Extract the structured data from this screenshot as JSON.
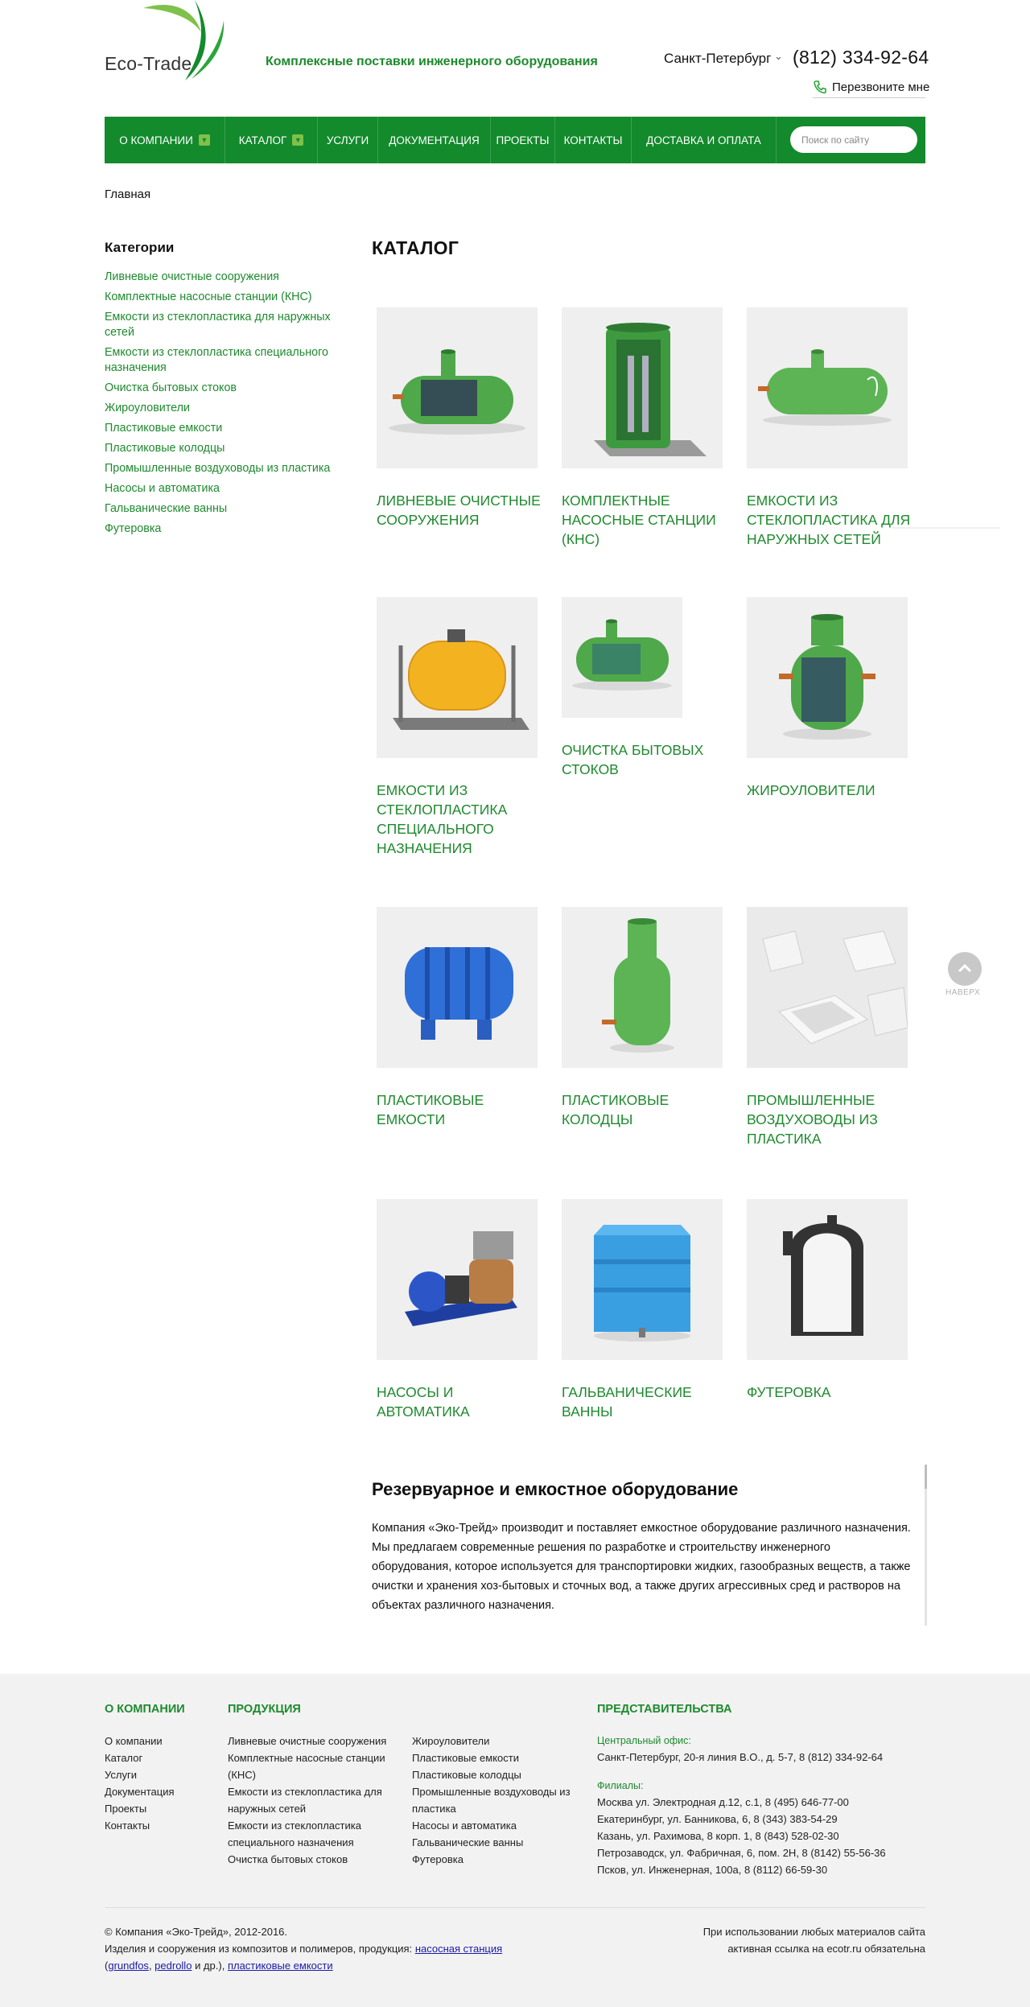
{
  "header": {
    "logo_text": "Eco-Trade",
    "tagline": "Комплексные поставки инженерного оборудования",
    "city": "Санкт-Петербург",
    "phone": "(812) 334-92-64",
    "callback": "Перезвоните мне"
  },
  "nav": {
    "items": [
      {
        "label": "О компании",
        "has_dropdown": true
      },
      {
        "label": "Каталог",
        "has_dropdown": true
      },
      {
        "label": "Услуги",
        "has_dropdown": false
      },
      {
        "label": "Документация",
        "has_dropdown": false
      },
      {
        "label": "Проекты",
        "has_dropdown": false
      },
      {
        "label": "Контакты",
        "has_dropdown": false
      },
      {
        "label": "Доставка и оплата",
        "has_dropdown": false
      }
    ],
    "search_placeholder": "Поиск по сайту"
  },
  "breadcrumb": "Главная",
  "sidebar": {
    "title": "Категории",
    "items": [
      "Ливневые очистные сооружения",
      "Комплектные насосные станции (КНС)",
      "Емкости из стеклопластика для наружных сетей",
      "Емкости из стеклопластика специального назначения",
      "Очистка бытовых стоков",
      "Жироуловители",
      "Пластиковые емкости",
      "Пластиковые колодцы",
      "Промышленные воздуховоды из пластика",
      "Насосы и автоматика",
      "Гальванические ванны",
      "Футеровка"
    ]
  },
  "catalog": {
    "title": "КАТАЛОГ",
    "cards": [
      {
        "label": "Ливневые очистные сооружения",
        "image": "green-horizontal-tank-cutaway"
      },
      {
        "label": "Комплектные насосные станции (КНС)",
        "image": "green-vertical-pump-station"
      },
      {
        "label": "Емкости из стеклопластика для наружных сетей",
        "image": "green-horizontal-tank"
      },
      {
        "label": "Емкости из стеклопластика специального назначения",
        "image": "yellow-tank-on-frame"
      },
      {
        "label": "Очистка бытовых стоков",
        "image": "green-tank-cutaway-small"
      },
      {
        "label": "Жироуловители",
        "image": "green-grease-trap"
      },
      {
        "label": "Пластиковые емкости",
        "image": "blue-ribbed-tank"
      },
      {
        "label": "Пластиковые колодцы",
        "image": "green-vertical-well"
      },
      {
        "label": "Промышленные воздуховоды из пластика",
        "image": "white-plastic-ducts"
      },
      {
        "label": "Насосы и автоматика",
        "image": "blue-pump-motor"
      },
      {
        "label": "Гальванические ванны",
        "image": "blue-bath-tank"
      },
      {
        "label": "Футеровка",
        "image": "lined-vessel-cutaway"
      }
    ]
  },
  "back_to_top": "НАВЕРХ",
  "about": {
    "title": "Резервуарное и емкостное оборудование",
    "text": "Компания «Эко-Трейд» производит и поставляет емкостное оборудование различного назначения. Мы предлагаем современные решения по разработке и строительству инженерного оборудования, которое используется для транспортировки жидких, газообразных веществ, а также очистки и хранения хоз-бытовых и сточных вод, а также других агрессивных сред и растворов на объектах различного назначения."
  },
  "footer": {
    "company_title": "О компании",
    "company_links": [
      "О компании",
      "Каталог",
      "Услуги",
      "Документация",
      "Проекты",
      "Контакты"
    ],
    "products_title": "Продукция",
    "products_col1": [
      "Ливневые очистные сооружения",
      "Комплектные насосные станции (КНС)",
      "Емкости из стеклопластика для наружных сетей",
      "Емкости из стеклопластика специального назначения",
      "Очистка бытовых стоков"
    ],
    "products_col2": [
      "Жироуловители",
      "Пластиковые емкости",
      "Пластиковые колодцы",
      "Промышленные воздуховоды из пластика",
      "Насосы и автоматика",
      "Гальванические ванны",
      "Футеровка"
    ],
    "offices_title": "Представительства",
    "central_label": "Центральный офис:",
    "central_text": "Санкт-Петербург, 20-я линия В.О., д. 5-7, 8 (812) 334-92-64",
    "branches_label": "Филиалы:",
    "branches": [
      "Москва ул. Электродная д.12, с.1, 8 (495) 646-77-00",
      "Екатеринбург, ул. Банникова, 6, 8 (343) 383-54-29",
      "Казань, ул. Рахимова, 8 корп. 1, 8 (843) 528-02-30",
      "Петрозаводск, ул. Фабричная, 6, пом. 2Н, 8 (8142) 55-56-36",
      "Псков, ул. Инженерная, 100а, 8 (8112) 66-59-30"
    ],
    "copyright": "© Компания «Эко-Трейд», 2012-2016.",
    "products_line_prefix": "Изделия и сооружения из композитов и полимеров, продукция:",
    "link_pump_station": "насосная станция",
    "link_grundfos": "grundfos",
    "link_pedrollo": "pedrollo",
    "and_others": "и др.),",
    "link_plastic_tanks": "пластиковые емкости",
    "notice_line1": "При использовании любых материалов сайта",
    "notice_line2": "активная ссылка на ecotr.ru обязательна"
  }
}
